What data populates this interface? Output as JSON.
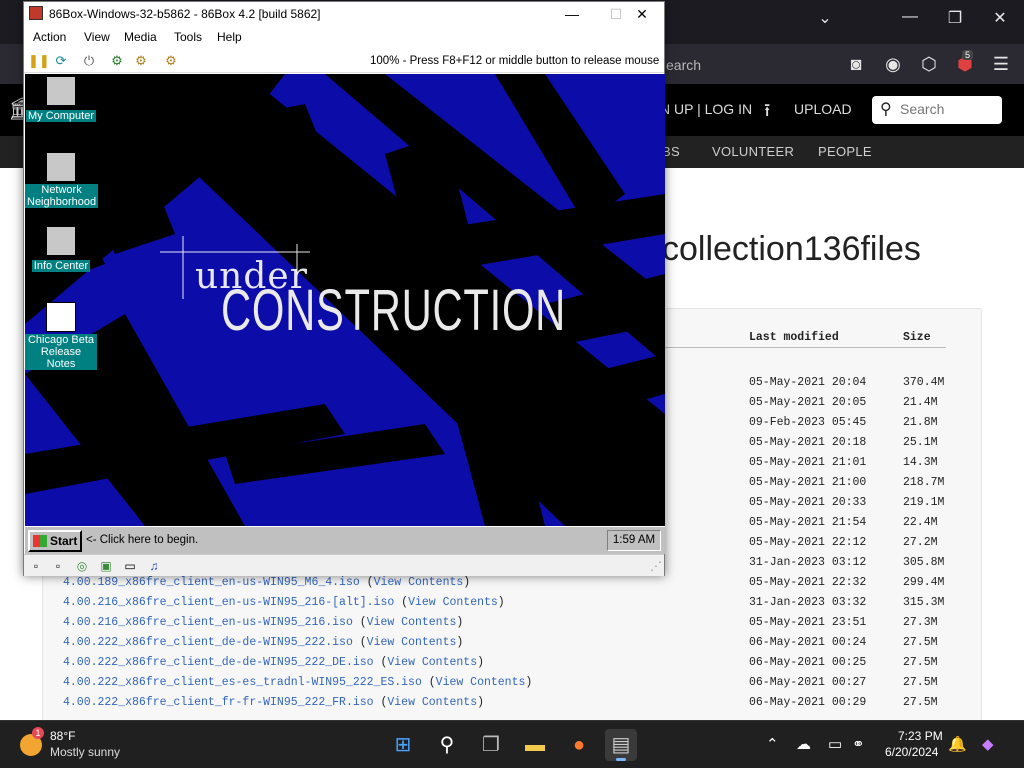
{
  "browser": {
    "url_partial": "earch",
    "ublock_badge": "5",
    "header": {
      "signup_login": "N UP | LOG IN",
      "upload": "UPLOAD",
      "search_placeholder": "Search"
    },
    "nav": [
      "BS",
      "VOLUNTEER",
      "PEOPLE"
    ],
    "collection_title": "collection136files",
    "columns": {
      "last_modified": "Last modified",
      "size": "Size"
    },
    "rows": [
      {
        "name": "",
        "view": "",
        "date": "05-May-2021 20:04",
        "size": "370.4M"
      },
      {
        "name": "",
        "view": "",
        "date": "05-May-2021 20:05",
        "size": "21.4M"
      },
      {
        "name": "",
        "view": "",
        "date": "09-Feb-2023 05:45",
        "size": "21.8M"
      },
      {
        "name": "",
        "view": "",
        "date": "05-May-2021 20:18",
        "size": "25.1M"
      },
      {
        "name": "",
        "view": "",
        "date": "05-May-2021 21:01",
        "size": "14.3M"
      },
      {
        "name": "",
        "view": "",
        "date": "05-May-2021 21:00",
        "size": "218.7M"
      },
      {
        "name": "",
        "view": "",
        "date": "05-May-2021 20:33",
        "size": "219.1M"
      },
      {
        "name": "",
        "view": "",
        "date": "05-May-2021 21:54",
        "size": "22.4M"
      },
      {
        "name": "",
        "view": "",
        "date": "05-May-2021 22:12",
        "size": "27.2M"
      },
      {
        "name": "",
        "view": "",
        "date": "31-Jan-2023 03:12",
        "size": "305.8M"
      },
      {
        "name": "4.00.189_x86fre_client_en-us-WIN95_M6_4.iso",
        "view": "View Contents",
        "date": "05-May-2021 22:32",
        "size": "299.4M"
      },
      {
        "name": "4.00.216_x86fre_client_en-us-WIN95_216-[alt].iso",
        "view": "View Contents",
        "date": "31-Jan-2023 03:32",
        "size": "315.3M"
      },
      {
        "name": "4.00.216_x86fre_client_en-us-WIN95_216.iso",
        "view": "View Contents",
        "date": "05-May-2021 23:51",
        "size": "27.3M"
      },
      {
        "name": "4.00.222_x86fre_client_de-de-WIN95_222.iso",
        "view": "View Contents",
        "date": "06-May-2021 00:24",
        "size": "27.5M"
      },
      {
        "name": "4.00.222_x86fre_client_de-de-WIN95_222_DE.iso",
        "view": "View Contents",
        "date": "06-May-2021 00:25",
        "size": "27.5M"
      },
      {
        "name": "4.00.222_x86fre_client_es-es_tradnl-WIN95_222_ES.iso",
        "view": "View Contents",
        "date": "06-May-2021 00:27",
        "size": "27.5M"
      },
      {
        "name": "4.00.222_x86fre_client_fr-fr-WIN95_222_FR.iso",
        "view": "View Contents",
        "date": "06-May-2021 00:29",
        "size": "27.5M"
      }
    ]
  },
  "vm": {
    "title": "86Box-Windows-32-b5862 - 86Box 4.2 [build 5862]",
    "menu": [
      "Action",
      "View",
      "Media",
      "Tools",
      "Help"
    ],
    "status": "100% - Press F8+F12 or middle button to release mouse",
    "desktop_icons": [
      {
        "label": "My Computer"
      },
      {
        "label": "Network Neighborhood"
      },
      {
        "label": "Info Center"
      },
      {
        "label": "Chicago Beta Release Notes"
      }
    ],
    "wallpaper_text": {
      "line1": "under",
      "line2": "CONSTRUCTION"
    },
    "guest_taskbar": {
      "start": "Start",
      "hint": "<- Click here to begin.",
      "clock": "1:59 AM"
    }
  },
  "taskbar": {
    "weather_badge": "1",
    "temperature": "88°F",
    "condition": "Mostly sunny",
    "time": "7:23 PM",
    "date": "6/20/2024"
  },
  "colors": {
    "guest_desktop": "#0c0ca8",
    "ia_link": "#3366bb",
    "win95_teal": "#008080"
  }
}
